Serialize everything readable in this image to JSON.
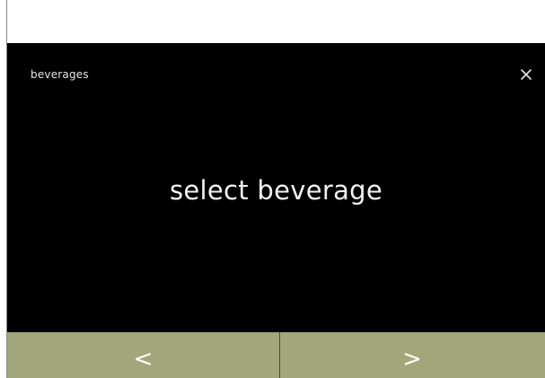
{
  "header": {
    "title": "beverages",
    "close_icon": "close-icon"
  },
  "main": {
    "prompt": "select beverage"
  },
  "nav": {
    "prev_label": "<",
    "next_label": ">",
    "prev_icon": "chevron-left-icon",
    "next_icon": "chevron-right-icon"
  },
  "colors": {
    "screen_background": "#000000",
    "nav_bar": "#a3a67a",
    "text": "#f2f2f2"
  }
}
